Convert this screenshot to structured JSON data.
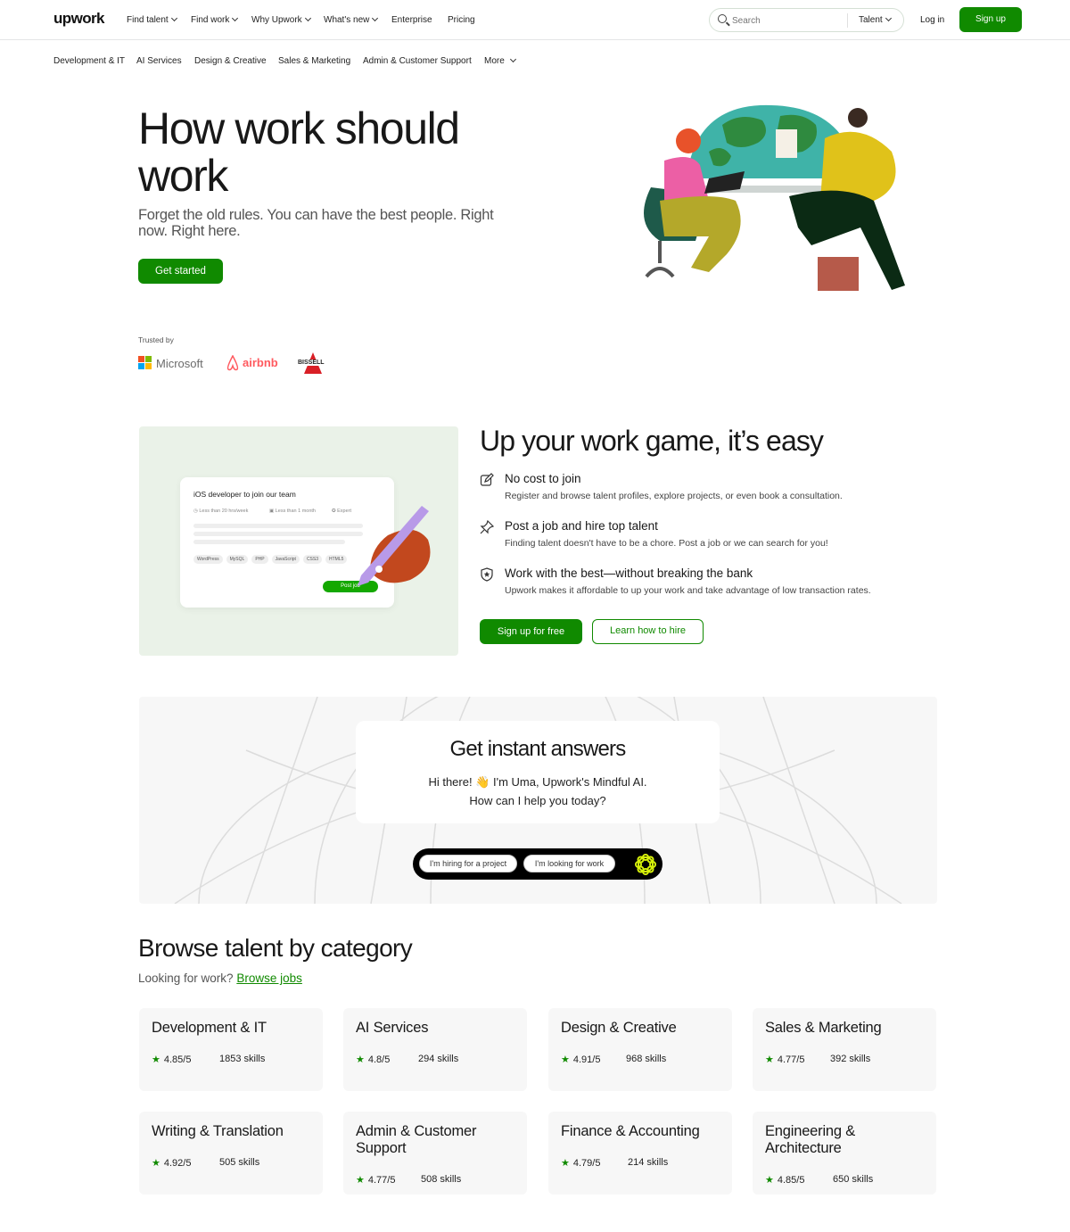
{
  "header": {
    "logo": "upwork",
    "nav": [
      "Find talent",
      "Find work",
      "Why Upwork",
      "What's new",
      "Enterprise",
      "Pricing"
    ],
    "search_placeholder": "Search",
    "search_scope": "Talent",
    "login": "Log in",
    "signup": "Sign up"
  },
  "subnav": [
    "Development & IT",
    "AI Services",
    "Design & Creative",
    "Sales & Marketing",
    "Admin & Customer Support",
    "More"
  ],
  "hero": {
    "title": "How work should work",
    "subtitle": "Forget the old rules. You can have the best people. Right now. Right here.",
    "cta": "Get started",
    "trusted_label": "Trusted by",
    "logos": [
      "Microsoft",
      "airbnb",
      "BISSELL"
    ]
  },
  "easy": {
    "title": "Up your work game, it’s easy",
    "card": {
      "title": "iOS developer to join our team",
      "meta": [
        "Less than 20 hrs/week",
        "Less than 1 month",
        "Expert"
      ],
      "tags": [
        "WordPress",
        "MySQL",
        "PHP",
        "JavaScript",
        "CSS3",
        "HTML5"
      ],
      "post": "Post job"
    },
    "features": [
      {
        "icon": "edit-icon",
        "title": "No cost to join",
        "desc": "Register and browse talent profiles, explore projects, or even book a consultation."
      },
      {
        "icon": "pin-icon",
        "title": "Post a job and hire top talent",
        "desc": "Finding talent doesn't have to be a chore. Post a job or we can search for you!"
      },
      {
        "icon": "shield-star-icon",
        "title": "Work with the best—without breaking the bank",
        "desc": "Upwork makes it affordable to up your work and take advantage of low transaction rates."
      }
    ],
    "primary_button": "Sign up for free",
    "secondary_button": "Learn how to hire"
  },
  "ai": {
    "title": "Get instant answers",
    "line1": "Hi there! 👋 I'm Uma, Upwork's Mindful AI.",
    "line2": "How can I help you today?",
    "chips": [
      "I'm hiring for a project",
      "I'm looking for work"
    ]
  },
  "browse": {
    "title": "Browse talent by category",
    "sub_prefix": "Looking for work?",
    "sub_link": "Browse jobs",
    "categories": [
      {
        "name": "Development & IT",
        "rating": "4.85/5",
        "skills": "1853 skills"
      },
      {
        "name": "AI Services",
        "rating": "4.8/5",
        "skills": "294 skills"
      },
      {
        "name": "Design & Creative",
        "rating": "4.91/5",
        "skills": "968 skills"
      },
      {
        "name": "Sales & Marketing",
        "rating": "4.77/5",
        "skills": "392 skills"
      },
      {
        "name": "Writing & Translation",
        "rating": "4.92/5",
        "skills": "505 skills"
      },
      {
        "name": "Admin & Customer Support",
        "rating": "4.77/5",
        "skills": "508 skills"
      },
      {
        "name": "Finance & Accounting",
        "rating": "4.79/5",
        "skills": "214 skills"
      },
      {
        "name": "Engineering & Architecture",
        "rating": "4.85/5",
        "skills": "650 skills"
      }
    ]
  },
  "colors": {
    "brand": "#108a00",
    "text": "#181818"
  }
}
